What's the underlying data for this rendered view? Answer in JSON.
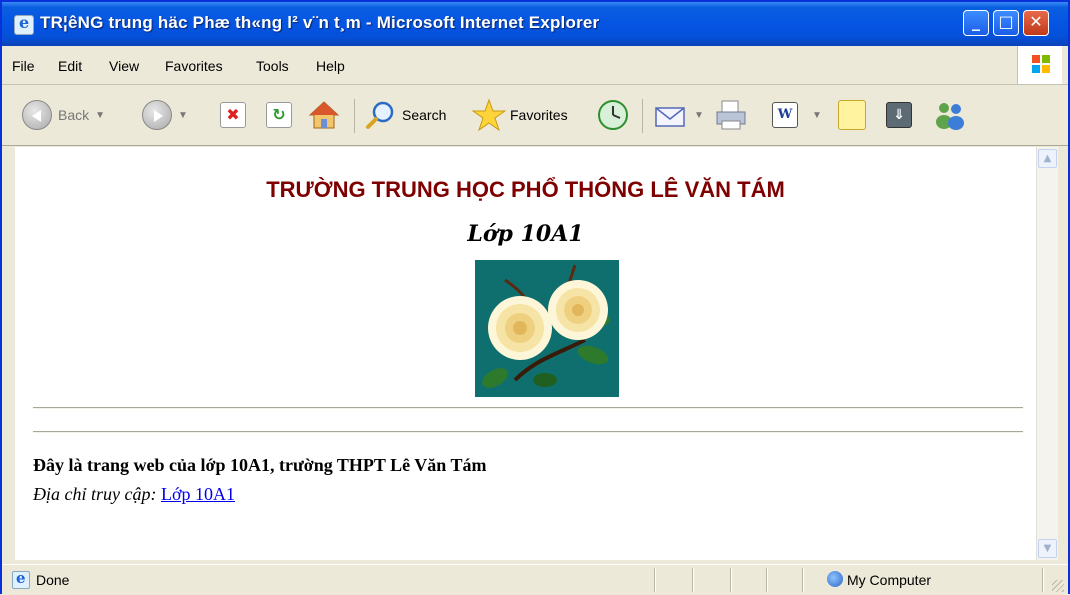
{
  "window": {
    "title": "TR¦êNG trung häc Phæ th«ng l² v¨n t¸m - Microsoft Internet Explorer"
  },
  "menu": [
    "File",
    "Edit",
    "View",
    "Favorites",
    "Tools",
    "Help"
  ],
  "toolbar": {
    "back_label": "Back",
    "search_label": "Search",
    "favorites_label": "Favorites"
  },
  "page": {
    "school_title": "TRƯỜNG TRUNG HỌC PHỔ THÔNG LÊ VĂN TÁM",
    "class_title": "Lớp 10A1",
    "intro": "Đây là trang web của lớp 10A1, trường THPT Lê Văn Tám",
    "address_label": "Địa chỉ truy cập:",
    "address_link": "Lớp 10A1"
  },
  "status": {
    "text": "Done",
    "zone": "My Computer"
  },
  "colors": {
    "titlebar": "#0554e3",
    "heading": "#7f0000",
    "link": "#0000ee"
  }
}
